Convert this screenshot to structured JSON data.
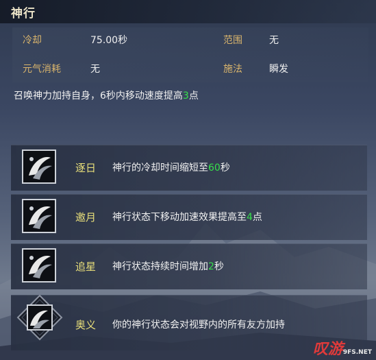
{
  "skill": {
    "title": "神行",
    "stats": {
      "cooldown_label": "冷却",
      "cooldown_value": "75.00秒",
      "range_label": "范围",
      "range_value": "无",
      "cost_label": "元气消耗",
      "cost_value": "无",
      "cast_label": "施法",
      "cast_value": "瞬发"
    },
    "desc_pre": "召唤神力加持自身，6秒内移动速度提高",
    "desc_num": "3",
    "desc_post": "点"
  },
  "upgrades": [
    {
      "name": "逐日",
      "pre": "神行的冷却时间缩短至",
      "num": "60",
      "post": "秒",
      "icon": "wind-swirl-icon"
    },
    {
      "name": "邀月",
      "pre": "神行状态下移动加速效果提高至",
      "num": "4",
      "post": "点",
      "icon": "wind-swirl-icon"
    },
    {
      "name": "追星",
      "pre": "神行状态持续时间增加",
      "num": "2",
      "post": "秒",
      "icon": "wind-swirl-icon"
    },
    {
      "name": "奥义",
      "pre": "你的神行状态会对视野内的所有友方加持",
      "num": "",
      "post": "",
      "icon": "wind-swirl-diamond-icon"
    }
  ],
  "watermark": {
    "text": "叹游",
    "small": "9FS.NET"
  },
  "colors": {
    "label_gold": "#d9b46c",
    "name_yellow": "#e9df7a",
    "number_green": "#37e04b"
  }
}
